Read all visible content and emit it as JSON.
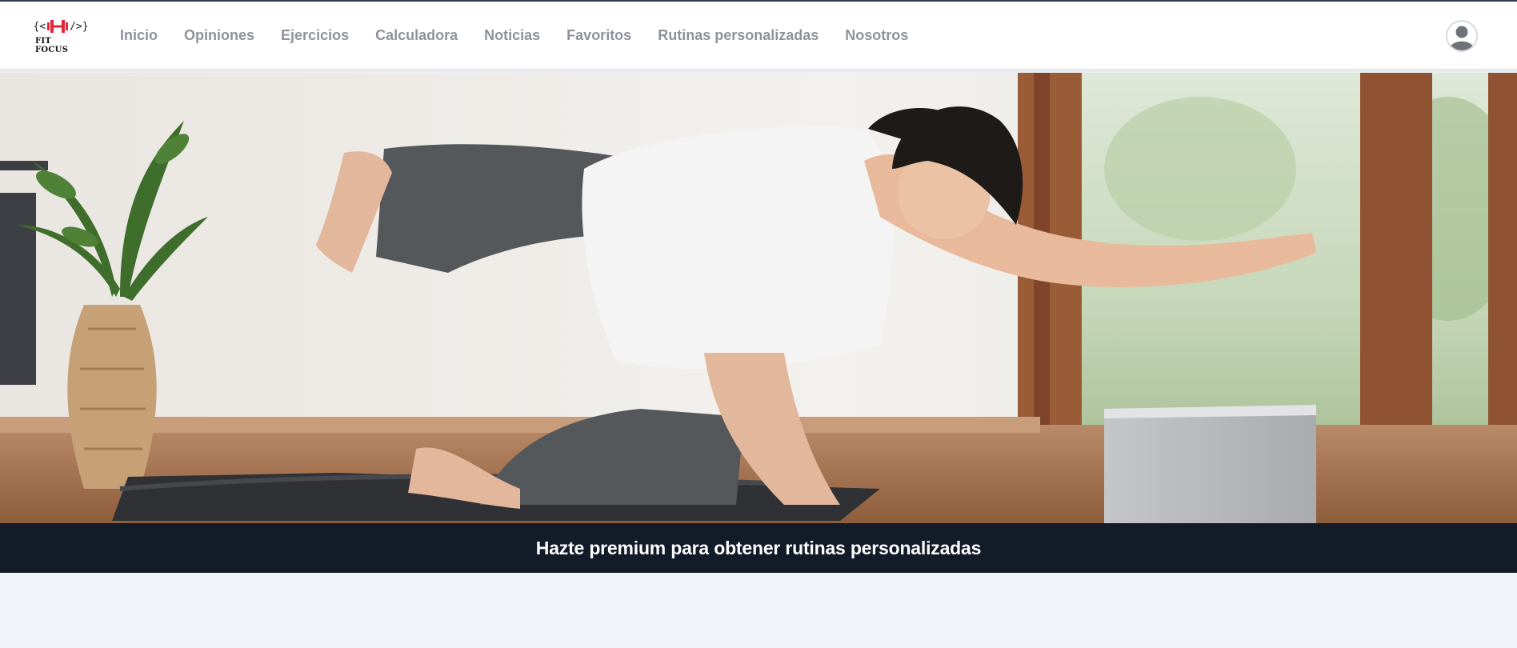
{
  "brand": {
    "logo_mark_left": "{<",
    "logo_mark_right": "/>}",
    "name": "FIT FOCUS"
  },
  "nav": {
    "items": [
      {
        "label": "Inicio"
      },
      {
        "label": "Opiniones"
      },
      {
        "label": "Ejercicios"
      },
      {
        "label": "Calculadora"
      },
      {
        "label": "Noticias"
      },
      {
        "label": "Favoritos"
      },
      {
        "label": "Rutinas personalizadas"
      },
      {
        "label": "Nosotros"
      }
    ]
  },
  "user": {
    "avatar_icon": "user-avatar-icon"
  },
  "hero": {
    "image_icon": "hero-image"
  },
  "banner": {
    "text": "Hazte premium para obtener rutinas personalizadas"
  },
  "colors": {
    "nav_text": "#8d929c",
    "banner_bg": "#131a28",
    "page_bg": "#f0f3f7",
    "logo_accent": "#e0283a"
  }
}
